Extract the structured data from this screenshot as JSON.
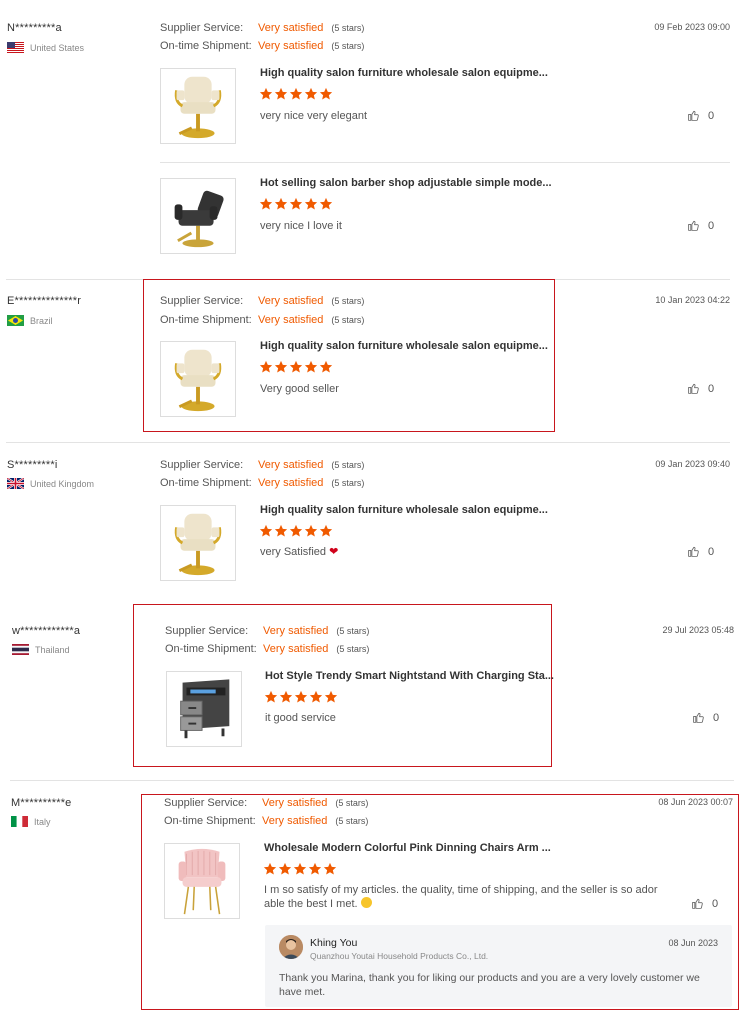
{
  "labels": {
    "supplier_service": "Supplier Service:",
    "on_time_shipment": "On-time Shipment:",
    "very_satisfied": "Very satisfied",
    "five_stars": "(5 stars)"
  },
  "colors": {
    "accent": "#f05a00",
    "highlight_border": "#c8161d",
    "star": "#f05a00"
  },
  "reviews": [
    {
      "user": "N*********a",
      "country": "United States",
      "flag": "us-flag",
      "date": "09 Feb 2023 09:00",
      "supplier_rating": "Very satisfied",
      "shipment_rating": "Very satisfied",
      "products": [
        {
          "title": "High quality salon furniture wholesale salon equipme...",
          "stars": 5,
          "comment": "very nice very elegant",
          "likes": "0",
          "image": "salon-chair-cream-image"
        },
        {
          "title": "Hot selling salon barber shop adjustable simple mode...",
          "stars": 5,
          "comment": "very nice I love it",
          "likes": "0",
          "image": "salon-chair-black-image"
        }
      ]
    },
    {
      "user": "E**************r",
      "country": "Brazil",
      "flag": "brazil-flag",
      "date": "10 Jan 2023 04:22",
      "supplier_rating": "Very satisfied",
      "shipment_rating": "Very satisfied",
      "products": [
        {
          "title": "High quality salon furniture wholesale salon equipme...",
          "stars": 5,
          "comment": "Very good seller",
          "likes": "0",
          "image": "salon-chair-cream-image"
        }
      ]
    },
    {
      "user": "S*********i",
      "country": "United Kingdom",
      "flag": "uk-flag",
      "date": "09 Jan 2023 09:40",
      "supplier_rating": "Very satisfied",
      "shipment_rating": "Very satisfied",
      "products": [
        {
          "title": "High quality salon furniture wholesale salon equipme...",
          "stars": 5,
          "comment": "very Satisfied",
          "likes": "0",
          "image": "salon-chair-cream-image"
        }
      ]
    },
    {
      "user": "w************a",
      "country": "Thailand",
      "flag": "thailand-flag",
      "date": "29 Jul 2023 05:48",
      "supplier_rating": "Very satisfied",
      "shipment_rating": "Very satisfied",
      "products": [
        {
          "title": "Hot Style Trendy Smart Nightstand With Charging Sta...",
          "stars": 5,
          "comment": "it good service",
          "likes": "0",
          "image": "nightstand-image"
        }
      ]
    },
    {
      "user": "M**********e",
      "country": "Italy",
      "flag": "italy-flag",
      "date": "08 Jun 2023 00:07",
      "supplier_rating": "Very satisfied",
      "shipment_rating": "Very satisfied",
      "products": [
        {
          "title": "Wholesale Modern Colorful Pink Dinning Chairs Arm ...",
          "stars": 5,
          "comment_line1": "I m so satisfy of my articles. the quality, time of shipping, and the seller is so ador",
          "comment_line2": "able the best I met. ",
          "likes": "0",
          "image": "pink-chair-image"
        }
      ],
      "reply": {
        "name": "Khing You",
        "company": "Quanzhou Youtai Household Products Co., Ltd.",
        "date": "08 Jun 2023",
        "text": "Thank you Marina, thank you for liking our products and you are a very lovely customer we have met."
      }
    }
  ]
}
